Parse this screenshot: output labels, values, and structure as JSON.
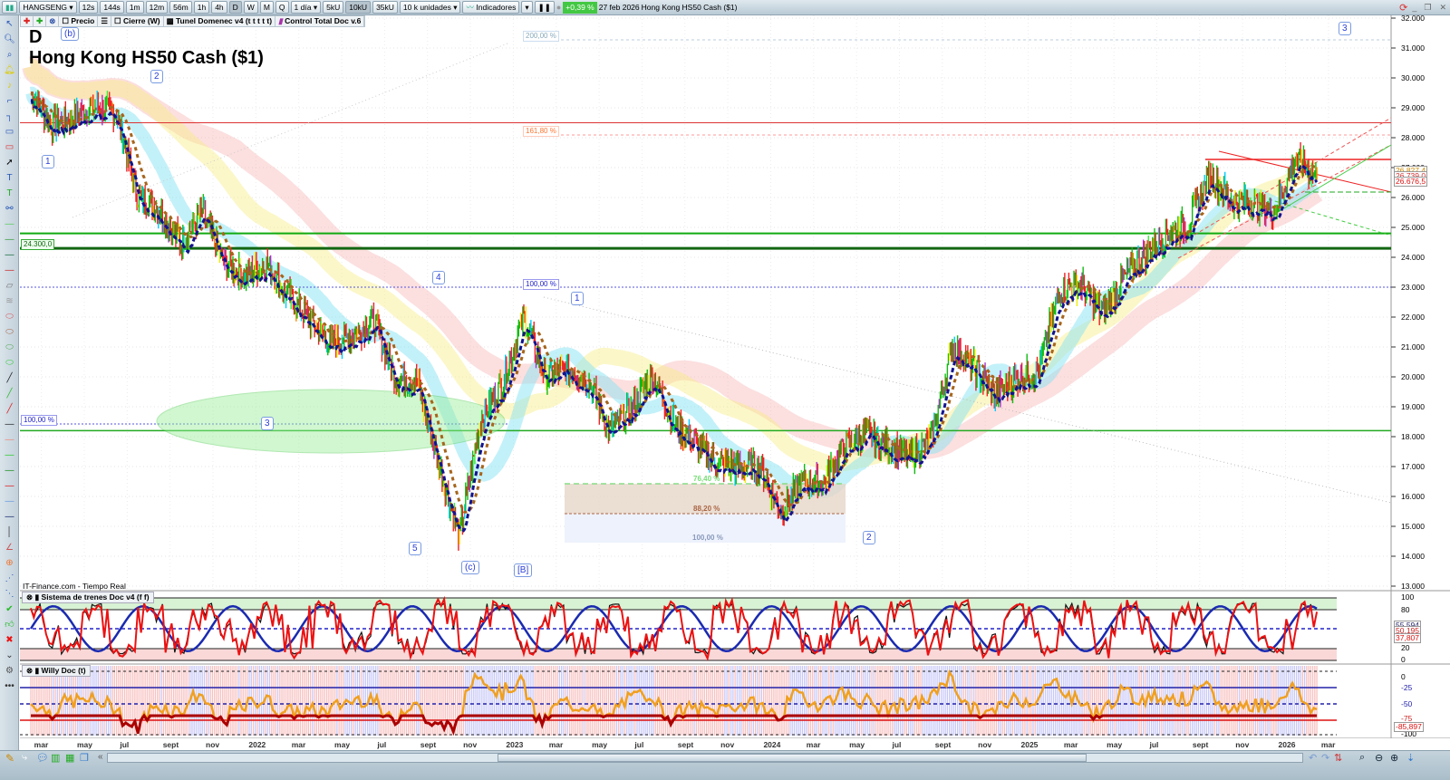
{
  "toolbar": {
    "symbol": "HANGSENG",
    "intervals": [
      "12s",
      "144s",
      "1m",
      "12m",
      "56m",
      "1h",
      "4h",
      "D",
      "W",
      "M",
      "Q"
    ],
    "period": "1 día",
    "units_buttons": [
      "5kU",
      "10kU",
      "35kU"
    ],
    "units_select": "10 k unidades",
    "indicators": "Indicadores",
    "change": "+0,39 %",
    "date": "27 feb 2026",
    "instrument": "Hong Kong HS50 Cash ($1)",
    "change_color": "#43c843"
  },
  "legend": {
    "items": [
      "Precio",
      "Cierre (W)",
      "Tunel Domenec v4 (t t t t t)",
      "Control Total Doc v.6"
    ]
  },
  "chart": {
    "timeframe": "D",
    "title": "Hong Kong HS50 Cash ($1)",
    "source": "IT-Finance.com - Tiempo Real",
    "wave_labels": [
      "(b)",
      "2",
      "1",
      "4",
      "3",
      "5",
      "(c)",
      "[B]",
      "1",
      "2",
      "3"
    ],
    "level_labels": {
      "fib200": "200,00 %",
      "fib161": "161,80 %",
      "fib100": "100,00 %",
      "left100": "100,00 %",
      "h24300": "24.300,0",
      "fib764": "76,40 %",
      "fib882": "88,20 %",
      "fib100b": "100,00 %"
    },
    "price_tags": [
      "26.827,4",
      "26.739,0",
      "26.676,5"
    ]
  },
  "chart_data": {
    "type": "candlestick",
    "x_start": "2021-02",
    "x_end": "2026-02",
    "monthly_close": [
      29500,
      28400,
      28700,
      29000,
      28800,
      26000,
      25600,
      24500,
      25500,
      23800,
      23400,
      23800,
      22700,
      21900,
      21100,
      21400,
      21900,
      20000,
      19900,
      17200,
      14700,
      18600,
      19800,
      22000,
      20000,
      20300,
      19900,
      18200,
      18900,
      20100,
      18400,
      17800,
      17100,
      17000,
      17000,
      15500,
      16500,
      16500,
      17700,
      18100,
      17700,
      17300,
      17900,
      21100,
      20300,
      19400,
      20000,
      20200,
      22900,
      23100,
      22100,
      23300,
      24100,
      24800,
      25100,
      26800,
      25900,
      25800,
      25600,
      27300,
      26700
    ],
    "yaxis_ticks": [
      "32.000",
      "31.000",
      "30.000",
      "29.000",
      "28.000",
      "27.000",
      "26.000",
      "25.000",
      "24.000",
      "23.000",
      "22.000",
      "21.000",
      "20.000",
      "19.000",
      "18.000",
      "17.000",
      "16.000",
      "15.000",
      "14.000",
      "13.000"
    ],
    "ylim": [
      13000,
      32000
    ],
    "hlines": [
      28500,
      24800,
      24300,
      23000,
      18200
    ],
    "xaxis_ticks": [
      "mar",
      "may",
      "jul",
      "sept",
      "nov",
      "2022",
      "mar",
      "may",
      "jul",
      "sept",
      "nov",
      "2023",
      "mar",
      "may",
      "jul",
      "sept",
      "nov",
      "2024",
      "mar",
      "may",
      "jul",
      "sept",
      "nov",
      "2025",
      "mar",
      "may",
      "jul",
      "sept",
      "nov",
      "2026",
      "mar"
    ]
  },
  "osc1": {
    "name": "Sistema de trenes Doc v4 (f f)",
    "ticks": [
      "100",
      "80",
      "20",
      "0"
    ],
    "values": [
      "55,594",
      "50,195",
      "37,807"
    ]
  },
  "osc2": {
    "name": "Willy Doc (t)",
    "ticks": [
      "0",
      "-25",
      "-50",
      "-75",
      "-100"
    ],
    "values": [
      "-85,897"
    ]
  }
}
